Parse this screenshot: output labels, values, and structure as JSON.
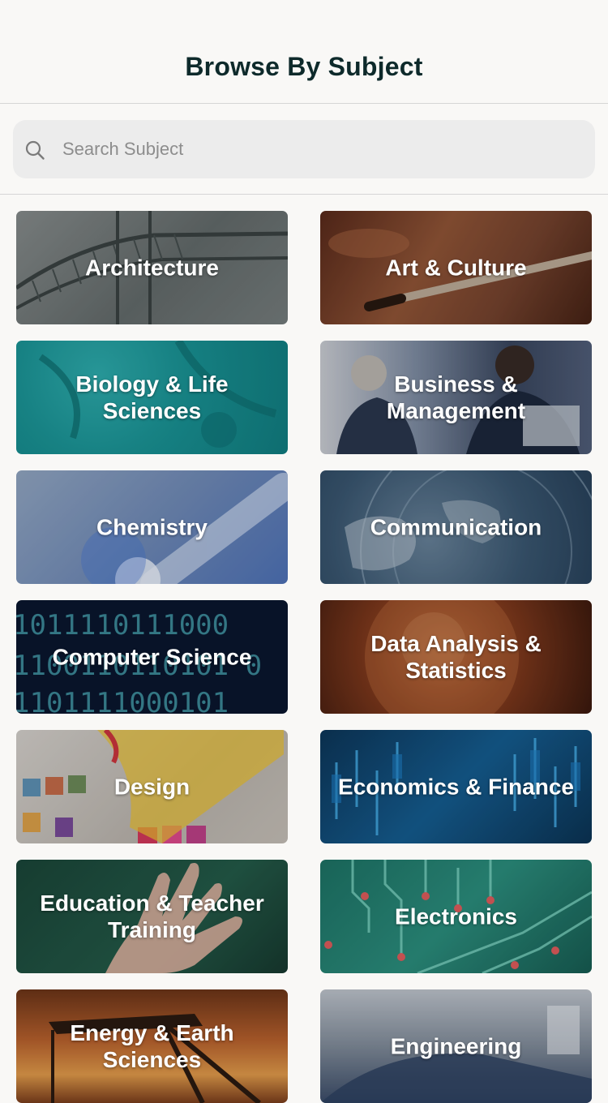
{
  "header": {
    "title": "Browse By Subject"
  },
  "search": {
    "placeholder": "Search Subject",
    "icon": "search-icon"
  },
  "subjects": [
    {
      "label": "Architecture",
      "theme": "bridge",
      "color": "#6d7575"
    },
    {
      "label": "Art & Culture",
      "theme": "paintbrush",
      "color": "#7a4a32"
    },
    {
      "label": "Biology & Life Sciences",
      "theme": "cells",
      "color": "#1e8c8e"
    },
    {
      "label": "Business & Management",
      "theme": "meeting",
      "color": "#4f607a"
    },
    {
      "label": "Chemistry",
      "theme": "molecule",
      "color": "#6b86b0"
    },
    {
      "label": "Communication",
      "theme": "globe",
      "color": "#3a5a78"
    },
    {
      "label": "Computer Science",
      "theme": "binary",
      "color": "#0a1730"
    },
    {
      "label": "Data Analysis & Statistics",
      "theme": "sphere",
      "color": "#7a3a1f"
    },
    {
      "label": "Design",
      "theme": "swatches",
      "color": "#b8b3ad"
    },
    {
      "label": "Economics & Finance",
      "theme": "candlestick",
      "color": "#0f3f66"
    },
    {
      "label": "Education & Teacher Training",
      "theme": "hand",
      "color": "#1d4a3c"
    },
    {
      "label": "Electronics",
      "theme": "circuit",
      "color": "#1b6e62"
    },
    {
      "label": "Energy & Earth Sciences",
      "theme": "oilrig",
      "color": "#a8542a"
    },
    {
      "label": "Engineering",
      "theme": "machine",
      "color": "#6f7a88"
    }
  ]
}
